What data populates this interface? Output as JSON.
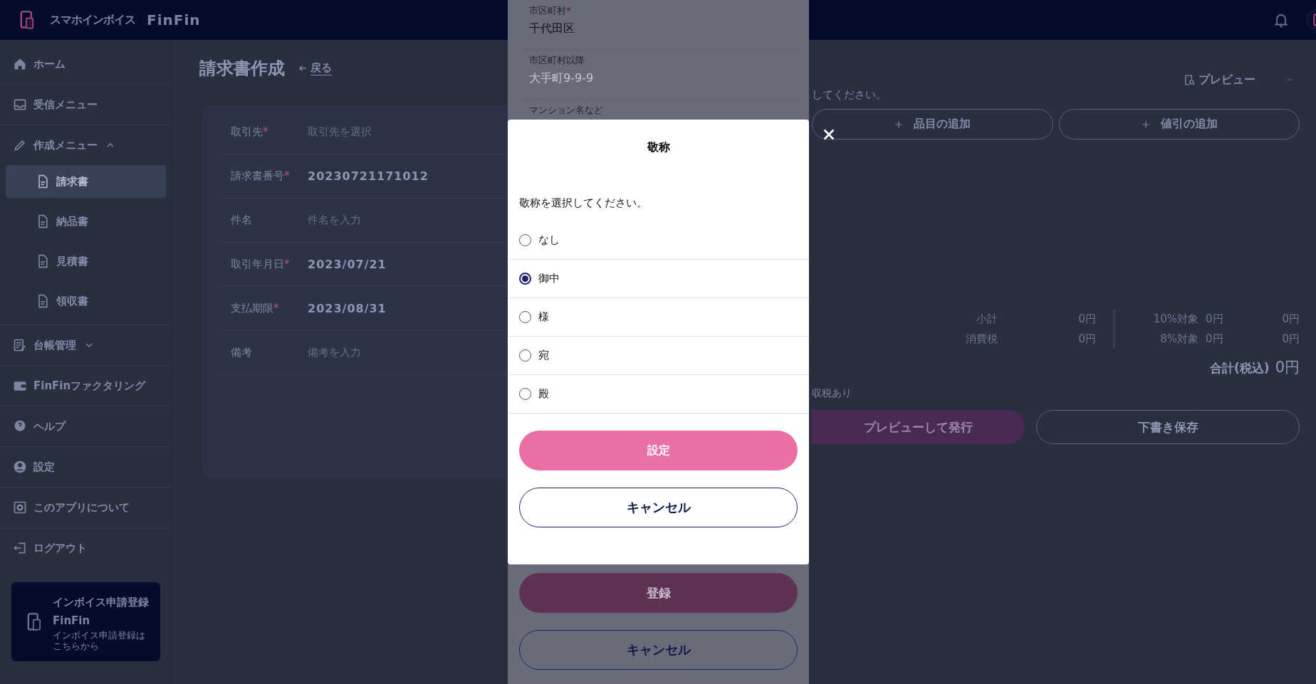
{
  "header": {
    "app_name": "スマホインボイス",
    "brand": "FinFin"
  },
  "sidebar": {
    "items": [
      {
        "label": "ホーム",
        "selected": false
      },
      {
        "label": "受信メニュー",
        "selected": false
      },
      {
        "label": "作成メニュー",
        "selected": false,
        "expanded": true,
        "children": [
          {
            "label": "請求書",
            "selected": true
          },
          {
            "label": "納品書",
            "selected": false
          },
          {
            "label": "見積書",
            "selected": false
          },
          {
            "label": "領収書",
            "selected": false
          }
        ]
      },
      {
        "label": "台帳管理",
        "selected": false,
        "expanded": false
      },
      {
        "label": "FinFinファクタリング",
        "selected": false
      },
      {
        "label": "ヘルプ",
        "selected": false
      },
      {
        "label": "設定",
        "selected": false
      },
      {
        "label": "このアプリについて",
        "selected": false
      },
      {
        "label": "ログアウト",
        "selected": false
      }
    ],
    "banner": {
      "title": "インボイス申請登録FinFin",
      "subtitle": "インボイス申請登録はこちらから"
    }
  },
  "page": {
    "title": "請求書作成",
    "back_link": "戻る",
    "fields": [
      {
        "label": "取引先",
        "required_mark": "*",
        "placeholder": "取引先を選択"
      },
      {
        "label": "請求書番号",
        "required_mark": "*",
        "value": "20230721171012"
      },
      {
        "label": "件名",
        "placeholder": "件名を入力"
      },
      {
        "label": "取引年月日",
        "required_mark": "*",
        "value": "2023/07/21"
      },
      {
        "label": "支払期限",
        "required_mark": "*",
        "value": "2023/08/31"
      },
      {
        "label": "備考",
        "placeholder": "備考を入力"
      }
    ],
    "preview_button": "プレビュー",
    "hint": "してください。",
    "add_buttons": [
      "品目の追加",
      "値引の追加"
    ],
    "summary": {
      "rows": [
        {
          "label": "小計",
          "amount": "0円",
          "rate_label": "10%対象",
          "rate_amount": "0円",
          "tax": "0円"
        },
        {
          "label": "消費税",
          "amount": "0円",
          "rate_label": "8%対象",
          "rate_amount": "0円",
          "tax": "0円"
        }
      ],
      "total_label": "合計(税込)",
      "total": "0円"
    },
    "note": "収税あり",
    "issue_button": "プレビューして発行",
    "draft_button": "下書き保存"
  },
  "address_panel": {
    "fields": [
      {
        "label": "市区町村",
        "required_mark": "*",
        "value": "千代田区"
      },
      {
        "label": "市区町村以降",
        "placeholder": "大手町9-9-9"
      },
      {
        "label": "マンション名など"
      }
    ],
    "submit_button": "登録",
    "cancel_button": "キャンセル"
  },
  "modal": {
    "title": "敬称",
    "prompt": "敬称を選択してください。",
    "options": [
      {
        "label": "なし",
        "selected": false
      },
      {
        "label": "御中",
        "selected": true
      },
      {
        "label": "様",
        "selected": false
      },
      {
        "label": "宛",
        "selected": false
      },
      {
        "label": "殿",
        "selected": false
      }
    ],
    "confirm_button": "設定",
    "cancel_button": "キャンセル"
  }
}
